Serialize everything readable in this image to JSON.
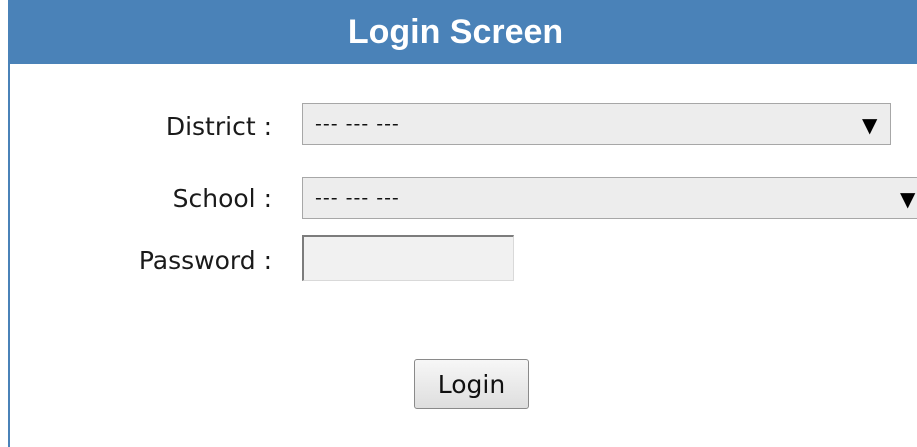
{
  "header": {
    "title": "Login Screen"
  },
  "form": {
    "district": {
      "label": "District :",
      "selected": "--- --- ---"
    },
    "school": {
      "label": "School :",
      "selected": "--- --- ---"
    },
    "password": {
      "label": "Password :",
      "value": ""
    },
    "login_button": {
      "label": "Login"
    }
  },
  "icons": {
    "dropdown_arrow": "▼"
  },
  "colors": {
    "header_bg": "#4a82b8",
    "header_text": "#ffffff"
  }
}
